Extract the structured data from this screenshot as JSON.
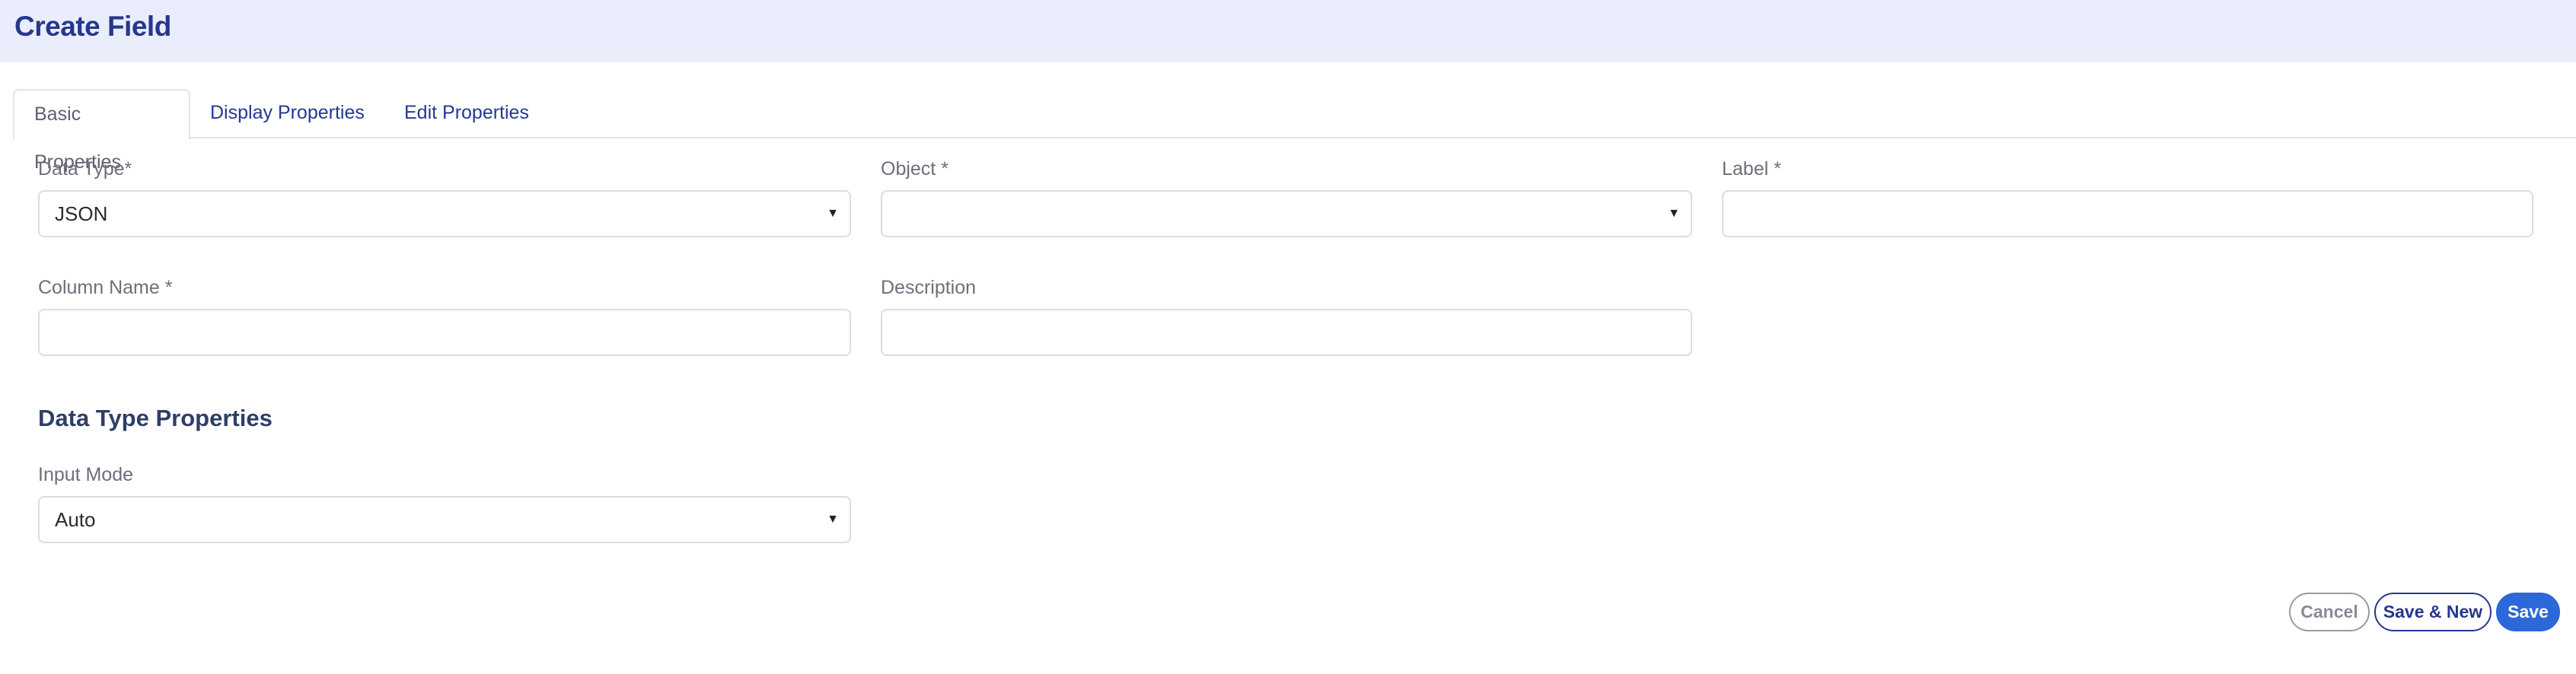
{
  "header": {
    "title": "Create Field"
  },
  "tabs": [
    {
      "label": "Basic Properties"
    },
    {
      "label": "Display Properties"
    },
    {
      "label": "Edit Properties"
    }
  ],
  "fields": {
    "data_type": {
      "label": "Data Type*",
      "value": "JSON"
    },
    "object": {
      "label": "Object *",
      "value": ""
    },
    "label": {
      "label": "Label *",
      "value": ""
    },
    "column_name": {
      "label": "Column Name *",
      "value": ""
    },
    "description": {
      "label": "Description",
      "value": ""
    }
  },
  "section": {
    "title": "Data Type Properties"
  },
  "input_mode": {
    "label": "Input Mode",
    "value": "Auto"
  },
  "buttons": {
    "cancel": "Cancel",
    "save_new": "Save & New",
    "save": "Save"
  },
  "colors": {
    "accent": "#2d68d8",
    "title": "#27378c",
    "header_bg": "#eaeefc"
  }
}
